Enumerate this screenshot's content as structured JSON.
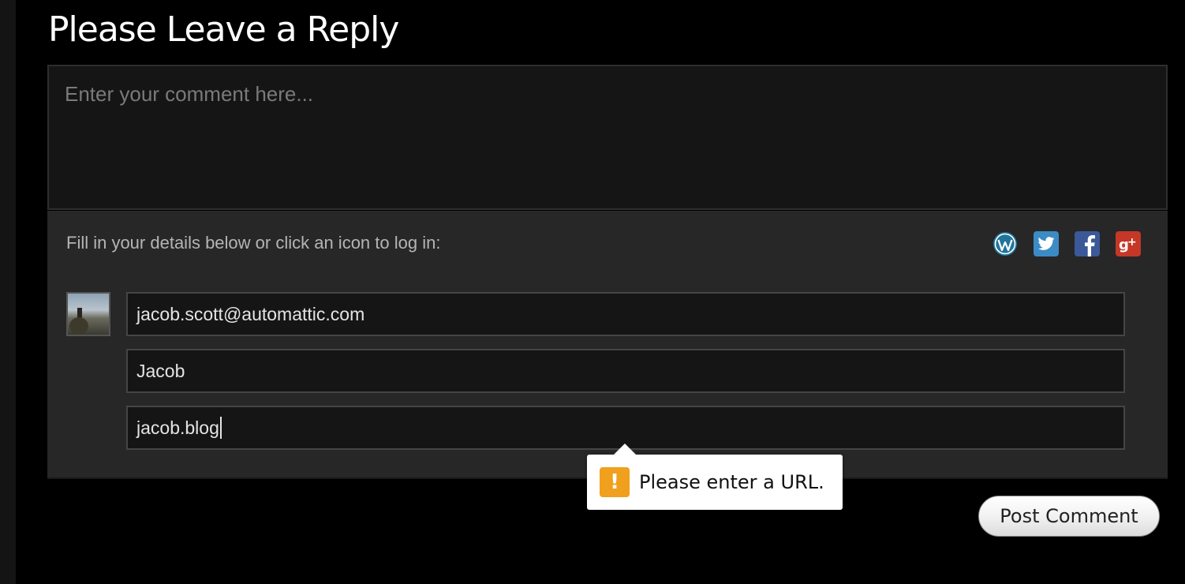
{
  "heading": "Please Leave a Reply",
  "comment": {
    "placeholder": "Enter your comment here..."
  },
  "details": {
    "prompt": "Fill in your details below or click an icon to log in:",
    "login_icons": [
      "wordpress-icon",
      "twitter-icon",
      "facebook-icon",
      "google-plus-icon"
    ],
    "login_colors": {
      "wordpress": "#21759b",
      "twitter": "#3b8bc5",
      "facebook": "#3b5998",
      "google_plus": "#c53727"
    },
    "email_value": "jacob.scott@automattic.com",
    "name_value": "Jacob",
    "website_value": "jacob.blog"
  },
  "validation": {
    "icon": "!",
    "message": "Please enter a URL.",
    "color": "#f0a01d"
  },
  "submit": {
    "label": "Post Comment"
  }
}
